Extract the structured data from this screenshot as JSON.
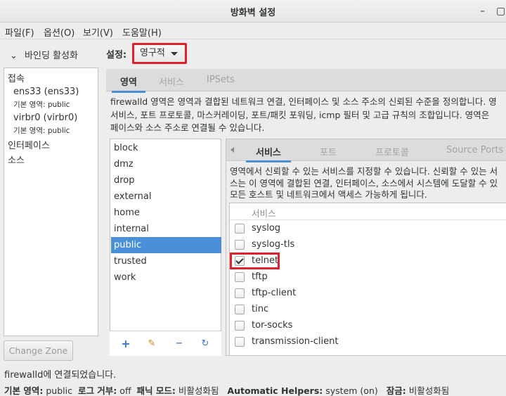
{
  "window": {
    "title": "방화벽 설정"
  },
  "menu": [
    "파일(F)",
    "옵션(O)",
    "보기(V)",
    "도움말(H)"
  ],
  "left": {
    "binding_toggle": "바인딩 활성화",
    "connections_header": "접속",
    "connections": [
      {
        "name": "ens33 (ens33)",
        "zone": "기본 영역: public"
      },
      {
        "name": "virbr0 (virbr0)",
        "zone": "기본 영역: public"
      }
    ],
    "interfaces_header": "인터페이스",
    "sources_header": "소스",
    "change_zone_button": "Change Zone"
  },
  "config": {
    "label": "설정:",
    "value": "영구적"
  },
  "top_tabs": [
    "영역",
    "서비스",
    "IPSets"
  ],
  "zone_description": [
    "firewalld 영역은 영역과 결합된 네트워크 연결, 인터페이스 및 소스 주소의 신뢰된 수준을 정의합니다. 영",
    "서비스, 포트 프로토콜, 마스커레이딩, 포트/패킷 포워딩, icmp 필터 및 고급 규칙의 조합입니다. 영역은",
    "페이스와 소스 주소로 연결될 수 있습니다."
  ],
  "zones": [
    "block",
    "dmz",
    "drop",
    "external",
    "home",
    "internal",
    "public",
    "trusted",
    "work"
  ],
  "selected_zone": "public",
  "inner_tabs": [
    "서비스",
    "포트",
    "프로토콜",
    "Source Ports"
  ],
  "services_description": [
    "영역에서 신뢰할 수 있는 서비스를 지정할 수 있습니다. 신뢰할 수 있는 서",
    "스는 이 영역에 결합된 연결, 인터페이스, 소스에서 시스템에 도달할 수 있",
    "모든 호스트 및 네트워크에서 액세스 가능하게 됩니다."
  ],
  "services_header": "서비스",
  "services": [
    {
      "name": "syslog",
      "checked": false
    },
    {
      "name": "syslog-tls",
      "checked": false
    },
    {
      "name": "telnet",
      "checked": true
    },
    {
      "name": "tftp",
      "checked": false
    },
    {
      "name": "tftp-client",
      "checked": false
    },
    {
      "name": "tinc",
      "checked": false
    },
    {
      "name": "tor-socks",
      "checked": false
    },
    {
      "name": "transmission-client",
      "checked": false
    }
  ],
  "status": {
    "message": "firewalld에 연결되었습니다.",
    "default_zone_label": "기본 영역:",
    "default_zone": "public",
    "log_denied_label": "로그 거부:",
    "log_denied": "off",
    "panic_label": "패닉 모드:",
    "panic": "비활성화됨",
    "helpers_label": "Automatic Helpers:",
    "helpers": "system (on)",
    "lockdown_label": "잠금:",
    "lockdown": "비활성화됨"
  }
}
